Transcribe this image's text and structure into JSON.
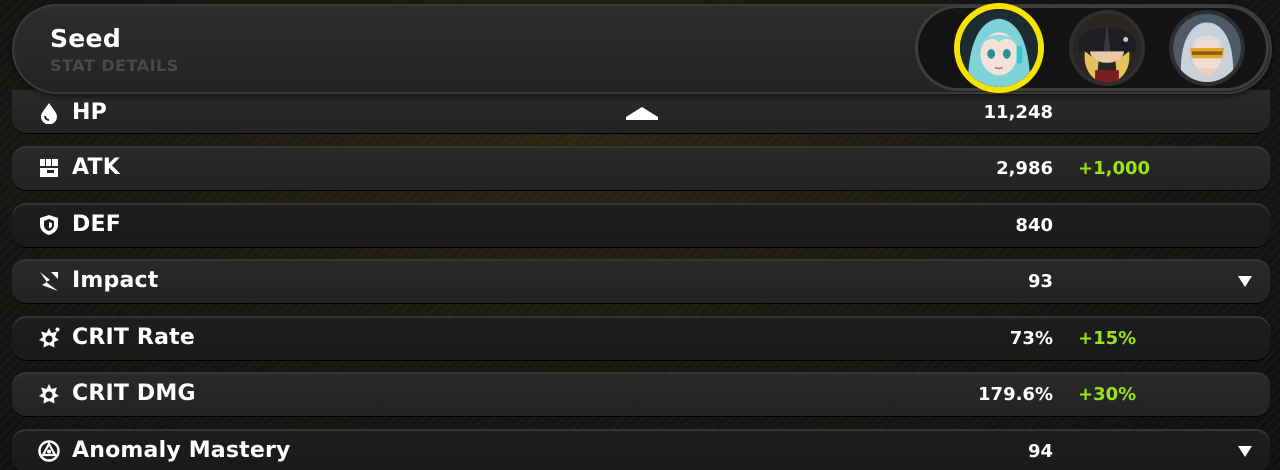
{
  "header": {
    "agent_name": "Seed",
    "subtitle": "STAT DETAILS"
  },
  "team": [
    {
      "name": "agent-portrait-1",
      "selected": true
    },
    {
      "name": "agent-portrait-2",
      "selected": false
    },
    {
      "name": "agent-portrait-3",
      "selected": false
    }
  ],
  "stats": [
    {
      "label": "HP",
      "value": "11,248",
      "bonus": "",
      "icon": "hp-drop-icon"
    },
    {
      "label": "ATK",
      "value": "2,986",
      "bonus": "+1,000",
      "icon": "atk-fist-icon"
    },
    {
      "label": "DEF",
      "value": "840",
      "bonus": "",
      "icon": "def-shield-icon"
    },
    {
      "label": "Impact",
      "value": "93",
      "bonus": "",
      "icon": "impact-icon"
    },
    {
      "label": "CRIT Rate",
      "value": "73%",
      "bonus": "+15%",
      "icon": "crit-rate-icon"
    },
    {
      "label": "CRIT DMG",
      "value": "179.6%",
      "bonus": "+30%",
      "icon": "crit-dmg-icon"
    },
    {
      "label": "Anomaly Mastery",
      "value": "94",
      "bonus": "",
      "icon": "anomaly-mastery-icon"
    }
  ],
  "colors": {
    "selected_ring": "#f7e300",
    "bonus": "#9be21a"
  }
}
